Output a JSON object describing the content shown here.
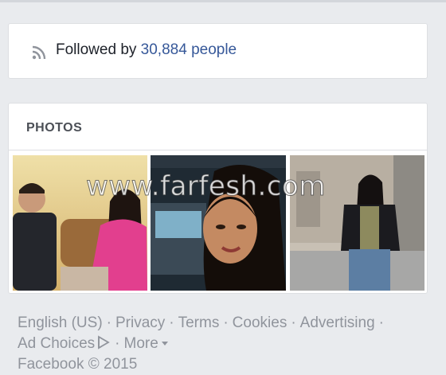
{
  "followers": {
    "prefix": "Followed by",
    "link": "30,884 people",
    "icon": "rss-icon"
  },
  "photos": {
    "title": "PHOTOS",
    "items": [
      {
        "alt": "photo-1"
      },
      {
        "alt": "photo-2"
      },
      {
        "alt": "photo-3"
      }
    ]
  },
  "watermark": "www.farfesh.com",
  "footer": {
    "links": [
      "English (US)",
      "Privacy",
      "Terms",
      "Cookies",
      "Advertising",
      "Ad Choices",
      "More"
    ],
    "separator": "·",
    "copyright": "Facebook © 2015"
  },
  "colors": {
    "background": "#e9ebee",
    "link": "#365899",
    "muted": "#90949c"
  }
}
